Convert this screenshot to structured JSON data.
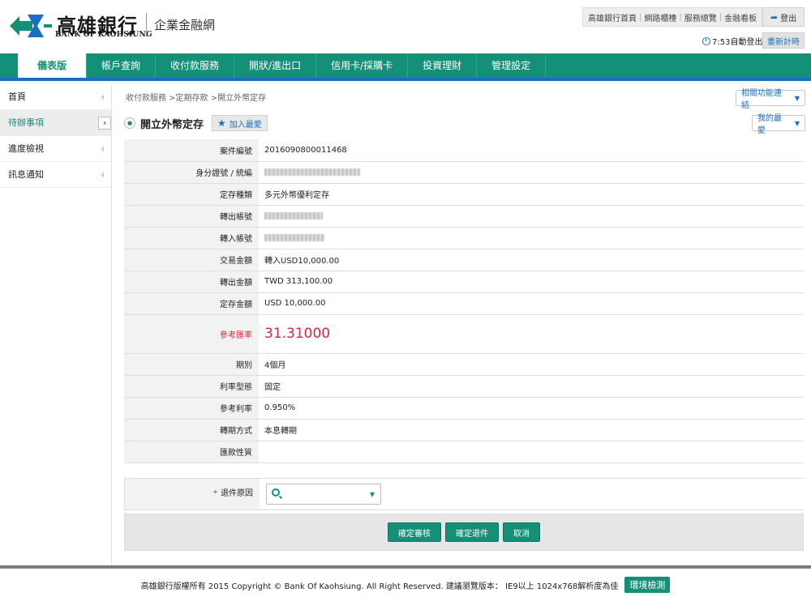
{
  "brand": {
    "name_cn": "高雄銀行",
    "name_en": "BANK OF KAOHSIUNG",
    "portal": "企業金融網",
    "colors": {
      "primary": "#148f78",
      "accent": "#1a6fc2",
      "highlight": "#d7263d"
    }
  },
  "toplinks": [
    "高雄銀行首頁",
    "網路櫃檯",
    "服務總覽",
    "金融看板"
  ],
  "logout_label": "登出",
  "session": {
    "timer": "7:53自動登出",
    "relogin_label": "重新計時"
  },
  "nav": [
    "儀表版",
    "帳戶查詢",
    "收付款服務",
    "開狀/進出口",
    "信用卡/採購卡",
    "投資理財",
    "管理設定"
  ],
  "sidebar": [
    {
      "label": "首頁",
      "chevron": "‹"
    },
    {
      "label": "待辦事項",
      "chevron": "›"
    },
    {
      "label": "進度檢視",
      "chevron": "‹"
    },
    {
      "label": "訊息通知",
      "chevron": "‹"
    }
  ],
  "breadcrumb": "收付款服務 >定期存款 >開立外幣定存",
  "related_label": "相關功能連結",
  "fav_menu_label": "我的最愛",
  "page_title": "開立外幣定存",
  "add_fav_label": "加入最愛",
  "details": [
    {
      "label": "案件編號",
      "value": "2016090800011468"
    },
    {
      "label": "身分證號 / 統編",
      "value": ""
    },
    {
      "label": "定存種類",
      "value": "多元外幣優利定存"
    },
    {
      "label": "轉出帳號",
      "value": ""
    },
    {
      "label": "轉入帳號",
      "value": ""
    },
    {
      "label": "交易金額",
      "value": "轉入USD10,000.00"
    },
    {
      "label": "轉出金額",
      "value": "TWD 313,100.00"
    },
    {
      "label": "定存金額",
      "value": "USD 10,000.00"
    },
    {
      "label": "參考匯率",
      "value": "31.31000"
    },
    {
      "label": "期別",
      "value": "4個月"
    },
    {
      "label": "利率型態",
      "value": "固定"
    },
    {
      "label": "參考利率",
      "value": "0.950%"
    },
    {
      "label": "轉期方式",
      "value": "本息轉期"
    },
    {
      "label": "匯款性質",
      "value": ""
    }
  ],
  "reason": {
    "required_mark": "*",
    "label": "退件原因",
    "value": ""
  },
  "actions": [
    "確定審核",
    "確定退件",
    "取消"
  ],
  "footer": {
    "text": "高雄銀行版權所有 2015 Copyright © Bank Of Kaohsiung. All Right Reserved. 建議瀏覽版本： IE9以上 1024x768解析度為佳",
    "env_label": "環境檢測"
  },
  "icons": {
    "logo": "kaohsiung-logo-icon",
    "logout": "logout-icon",
    "clock": "clock-icon",
    "star": "star-icon",
    "search": "search-icon",
    "caret": "caret-down-icon"
  }
}
